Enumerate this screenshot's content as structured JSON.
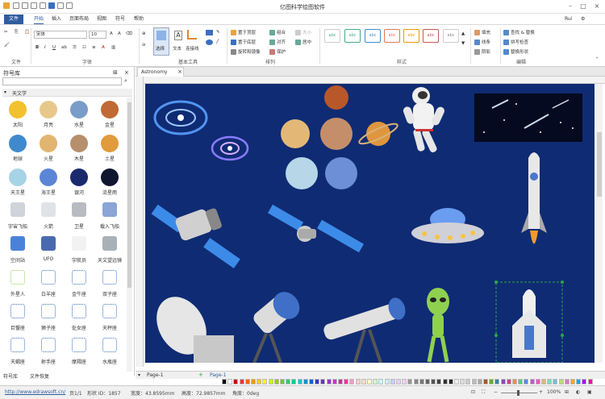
{
  "app": {
    "title": "亿图科学绘图软件",
    "user": "Rui"
  },
  "menu": {
    "file": "文件",
    "items": [
      "开始",
      "插入",
      "页面布局",
      "视图",
      "符号",
      "帮助"
    ]
  },
  "ribbon": {
    "groups": [
      "文件",
      "字体",
      "基本工具",
      "排列",
      "样式",
      "编辑"
    ],
    "font": {
      "name": "宋体",
      "size": "10"
    },
    "tools": [
      "选择",
      "文本",
      "连接线"
    ],
    "arrange": [
      "置于顶层",
      "置于底层",
      "旋转和镜像",
      "组合",
      "对齐",
      "大小",
      "居中",
      "保护"
    ],
    "style_cells": [
      "abc",
      "abc",
      "abc",
      "abc",
      "abc",
      "abc",
      "abc"
    ],
    "fill_items": [
      "填充",
      "线条",
      "阴影"
    ],
    "edit_items": [
      "查找 & 替换",
      "拼写检查",
      "替换形状"
    ]
  },
  "sidebar": {
    "title": "符号库",
    "search_placeholder": "",
    "category": "天文学",
    "symbols": [
      "太阳",
      "月亮",
      "水星",
      "金星",
      "地球",
      "火星",
      "木星",
      "土星",
      "天王星",
      "海王星",
      "银河",
      "流星雨",
      "宇宙飞船",
      "火箭",
      "卫星",
      "载入飞船",
      "空间站",
      "UFO",
      "宇航员",
      "天文望远镜",
      "外星人",
      "白羊座",
      "金牛座",
      "双子座",
      "巨蟹座",
      "狮子座",
      "处女座",
      "天秤座",
      "天蝎座",
      "射手座",
      "摩羯座",
      "水瓶座"
    ],
    "bottom_tabs": [
      "符号库",
      "文件恢复"
    ]
  },
  "document": {
    "tab": "Astronomy"
  },
  "pages": {
    "current": "Page-1",
    "tab": "Page-1"
  },
  "status": {
    "url": "http://www.edrawsoft.cn/",
    "page": "页1/1",
    "shape_id": "形状 ID：1857",
    "width": "宽度：43.8595mm",
    "height": "高度：72.9857mm",
    "angle": "角度：0deg",
    "zoom": "100%"
  },
  "colors": {
    "accent": "#2f5d9e",
    "canvas": "#0f2b73"
  }
}
